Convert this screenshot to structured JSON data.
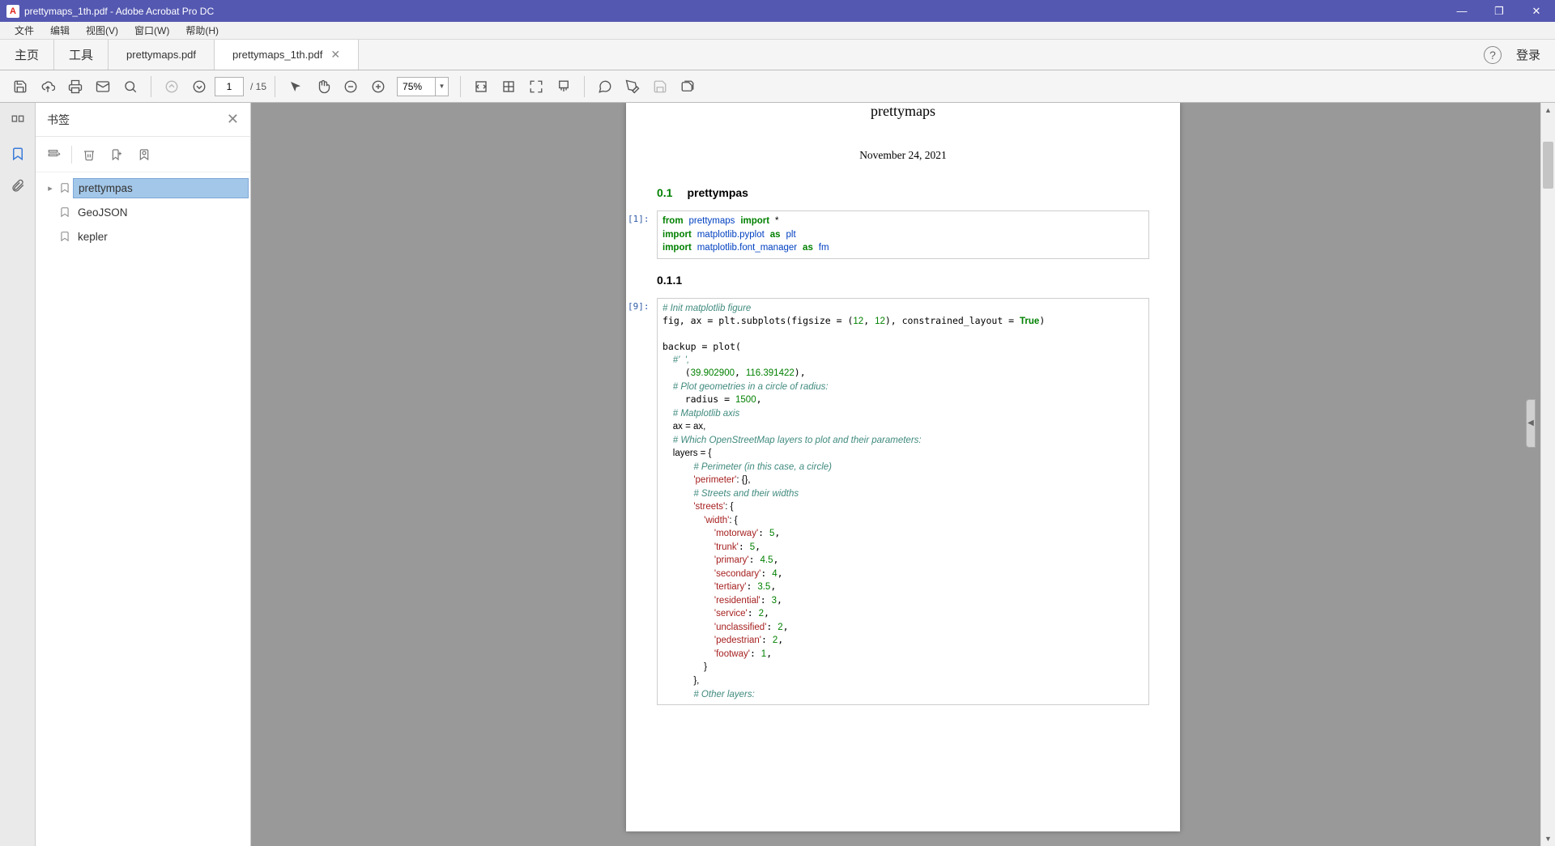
{
  "window": {
    "title": "prettymaps_1th.pdf - Adobe Acrobat Pro DC",
    "minimize": "—",
    "maximize": "❐",
    "close": "✕"
  },
  "menu": {
    "file": "文件",
    "edit": "编辑",
    "view": "视图(V)",
    "window": "窗口(W)",
    "help": "帮助(H)"
  },
  "tabs": {
    "home": "主页",
    "tools": "工具",
    "doc1": "prettymaps.pdf",
    "doc2": "prettymaps_1th.pdf",
    "login": "登录"
  },
  "toolbar": {
    "page_current": "1",
    "page_total": "/ 15",
    "zoom": "75%"
  },
  "panel": {
    "title": "书签",
    "items": {
      "a": "prettympas",
      "b": "GeoJSON",
      "c": "kepler"
    }
  },
  "doc": {
    "title": "prettymaps",
    "date": "November 24, 2021",
    "sec1_num": "0.1",
    "sec1_title": "prettympas",
    "sec2_num": "0.1.1",
    "cell1_prompt": "[1]:",
    "cell2_prompt": "[9]:",
    "code1": {
      "l1a": "from",
      "l1b": "prettymaps",
      "l1c": "import",
      "l1d": "*",
      "l2a": "import",
      "l2b": "matplotlib.pyplot",
      "l2c": "as",
      "l2d": "plt",
      "l3a": "import",
      "l3b": "matplotlib.font_manager",
      "l3c": "as",
      "l3d": "fm"
    },
    "code2": {
      "c1": "# Init matplotlib figure",
      "l2": "fig, ax = plt.subplots(figsize = (12, 12), constrained_layout = True)",
      "l4": "backup = plot(",
      "c5": "    #'  ',",
      "l6": "    (39.902900, 116.391422),",
      "c7": "    # Plot geometries in a circle of radius:",
      "l8": "    radius = 1500,",
      "c9": "    # Matplotlib axis",
      "l10": "    ax = ax,",
      "c11": "    # Which OpenStreetMap layers to plot and their parameters:",
      "l12": "    layers = {",
      "c13": "            # Perimeter (in this case, a circle)",
      "l14a": "            ",
      "l14s": "'perimeter'",
      "l14b": ": {},",
      "c15": "            # Streets and their widths",
      "l16a": "            ",
      "l16s": "'streets'",
      "l16b": ": {",
      "l17a": "                ",
      "l17s": "'width'",
      "l17b": ": {",
      "l18a": "                    ",
      "l18s": "'motorway'",
      "l18b": ": 5,",
      "l19a": "                    ",
      "l19s": "'trunk'",
      "l19b": ": 5,",
      "l20a": "                    ",
      "l20s": "'primary'",
      "l20b": ": 4.5,",
      "l21a": "                    ",
      "l21s": "'secondary'",
      "l21b": ": 4,",
      "l22a": "                    ",
      "l22s": "'tertiary'",
      "l22b": ": 3.5,",
      "l23a": "                    ",
      "l23s": "'residential'",
      "l23b": ": 3,",
      "l24a": "                    ",
      "l24s": "'service'",
      "l24b": ": 2,",
      "l25a": "                    ",
      "l25s": "'unclassified'",
      "l25b": ": 2,",
      "l26a": "                    ",
      "l26s": "'pedestrian'",
      "l26b": ": 2,",
      "l27a": "                    ",
      "l27s": "'footway'",
      "l27b": ": 1,",
      "l28": "                }",
      "l29": "            },",
      "c30": "            # Other layers:"
    }
  }
}
